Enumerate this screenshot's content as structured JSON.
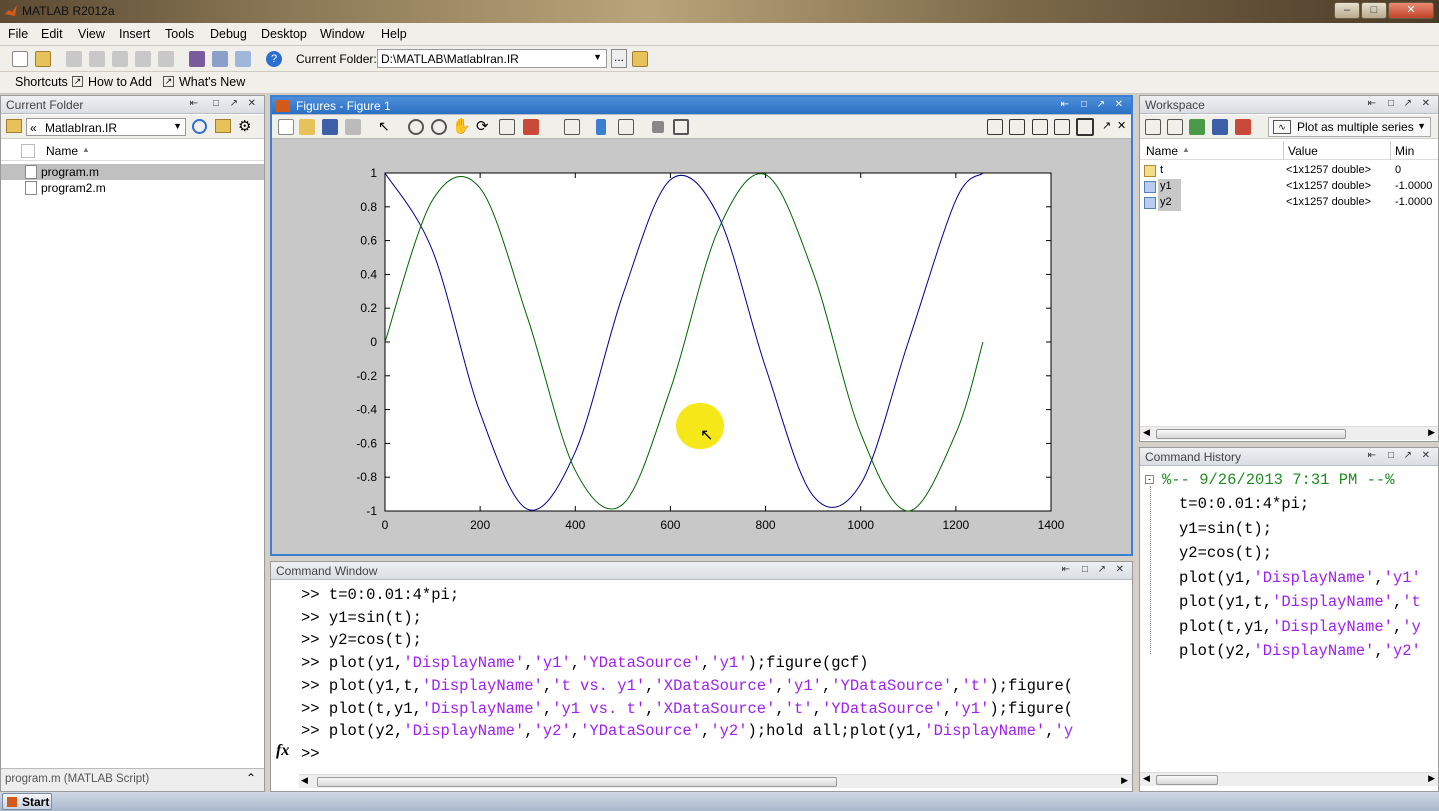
{
  "app": {
    "title": "MATLAB  R2012a"
  },
  "menu": [
    "File",
    "Edit",
    "View",
    "Insert",
    "Tools",
    "Debug",
    "Desktop",
    "Window",
    "Help"
  ],
  "toolbar": {
    "folder_label": "Current Folder:",
    "folder_value": "D:\\MATLAB\\MatlabIran.IR"
  },
  "shortcuts": {
    "shortcuts": "Shortcuts",
    "how_to_add": "How to Add",
    "whats_new": "What's New"
  },
  "current_folder": {
    "title": "Current Folder",
    "path": "MatlabIran.IR",
    "column": "Name",
    "files": [
      "program.m",
      "program2.m"
    ],
    "status": "program.m (MATLAB Script)"
  },
  "figure": {
    "title": "Figures - Figure 1"
  },
  "workspace": {
    "title": "Workspace",
    "plot_button": "Plot as multiple series",
    "columns": [
      "Name",
      "Value",
      "Min"
    ],
    "vars": [
      {
        "name": "t",
        "value": "<1x1257 double>",
        "min": "0"
      },
      {
        "name": "y1",
        "value": "<1x1257 double>",
        "min": "-1.0000"
      },
      {
        "name": "y2",
        "value": "<1x1257 double>",
        "min": "-1.0000"
      }
    ]
  },
  "command_window": {
    "title": "Command Window",
    "lines": [
      [
        {
          "t": ">> t=0:0.01:4*pi;",
          "s": 0
        }
      ],
      [
        {
          "t": ">> y1=sin(t);",
          "s": 0
        }
      ],
      [
        {
          "t": ">> y2=cos(t);",
          "s": 0
        }
      ],
      [
        {
          "t": ">> plot(y1,",
          "s": 0
        },
        {
          "t": "'DisplayName'",
          "s": 1
        },
        {
          "t": ",",
          "s": 0
        },
        {
          "t": "'y1'",
          "s": 1
        },
        {
          "t": ",",
          "s": 0
        },
        {
          "t": "'YDataSource'",
          "s": 1
        },
        {
          "t": ",",
          "s": 0
        },
        {
          "t": "'y1'",
          "s": 1
        },
        {
          "t": ");figure(gcf)",
          "s": 0
        }
      ],
      [
        {
          "t": ">> plot(y1,t,",
          "s": 0
        },
        {
          "t": "'DisplayName'",
          "s": 1
        },
        {
          "t": ",",
          "s": 0
        },
        {
          "t": "'t vs. y1'",
          "s": 1
        },
        {
          "t": ",",
          "s": 0
        },
        {
          "t": "'XDataSource'",
          "s": 1
        },
        {
          "t": ",",
          "s": 0
        },
        {
          "t": "'y1'",
          "s": 1
        },
        {
          "t": ",",
          "s": 0
        },
        {
          "t": "'YDataSource'",
          "s": 1
        },
        {
          "t": ",",
          "s": 0
        },
        {
          "t": "'t'",
          "s": 1
        },
        {
          "t": ");figure(",
          "s": 0
        }
      ],
      [
        {
          "t": ">> plot(t,y1,",
          "s": 0
        },
        {
          "t": "'DisplayName'",
          "s": 1
        },
        {
          "t": ",",
          "s": 0
        },
        {
          "t": "'y1 vs. t'",
          "s": 1
        },
        {
          "t": ",",
          "s": 0
        },
        {
          "t": "'XDataSource'",
          "s": 1
        },
        {
          "t": ",",
          "s": 0
        },
        {
          "t": "'t'",
          "s": 1
        },
        {
          "t": ",",
          "s": 0
        },
        {
          "t": "'YDataSource'",
          "s": 1
        },
        {
          "t": ",",
          "s": 0
        },
        {
          "t": "'y1'",
          "s": 1
        },
        {
          "t": ");figure(",
          "s": 0
        }
      ],
      [
        {
          "t": ">> plot(y2,",
          "s": 0
        },
        {
          "t": "'DisplayName'",
          "s": 1
        },
        {
          "t": ",",
          "s": 0
        },
        {
          "t": "'y2'",
          "s": 1
        },
        {
          "t": ",",
          "s": 0
        },
        {
          "t": "'YDataSource'",
          "s": 1
        },
        {
          "t": ",",
          "s": 0
        },
        {
          "t": "'y2'",
          "s": 1
        },
        {
          "t": ");hold all;plot(y1,",
          "s": 0
        },
        {
          "t": "'DisplayName'",
          "s": 1
        },
        {
          "t": ",",
          "s": 0
        },
        {
          "t": "'y",
          "s": 1
        }
      ]
    ],
    "fx": "fx",
    "prompt": ">>"
  },
  "command_history": {
    "title": "Command History",
    "session": "%-- 9/26/2013 7:31 PM --%",
    "lines": [
      [
        {
          "t": "t=0:0.01:4*pi;",
          "s": 0
        }
      ],
      [
        {
          "t": "y1=sin(t);",
          "s": 0
        }
      ],
      [
        {
          "t": "y2=cos(t);",
          "s": 0
        }
      ],
      [
        {
          "t": "plot(y1,",
          "s": 0
        },
        {
          "t": "'DisplayName'",
          "s": 1
        },
        {
          "t": ",",
          "s": 0
        },
        {
          "t": "'y1'",
          "s": 1
        }
      ],
      [
        {
          "t": "plot(y1,t,",
          "s": 0
        },
        {
          "t": "'DisplayName'",
          "s": 1
        },
        {
          "t": ",",
          "s": 0
        },
        {
          "t": "'t",
          "s": 1
        }
      ],
      [
        {
          "t": "plot(t,y1,",
          "s": 0
        },
        {
          "t": "'DisplayName'",
          "s": 1
        },
        {
          "t": ",",
          "s": 0
        },
        {
          "t": "'y",
          "s": 1
        }
      ],
      [
        {
          "t": "plot(y2,",
          "s": 0
        },
        {
          "t": "'DisplayName'",
          "s": 1
        },
        {
          "t": ",",
          "s": 0
        },
        {
          "t": "'y2'",
          "s": 1
        }
      ]
    ]
  },
  "taskbar": {
    "start": "Start"
  },
  "chart_data": {
    "type": "line",
    "x": [
      0,
      100,
      200,
      300,
      400,
      500,
      600,
      700,
      800,
      900,
      1000,
      1100,
      1200,
      1257
    ],
    "series": [
      {
        "color": "#00008b",
        "values": [
          1,
          0.54,
          -0.42,
          -0.99,
          -0.65,
          0.28,
          0.96,
          0.75,
          -0.15,
          -0.91,
          -0.84,
          0.0,
          0.84,
          1.0
        ]
      },
      {
        "color": "#006400",
        "values": [
          0,
          0.84,
          0.91,
          0.14,
          -0.76,
          -0.96,
          -0.28,
          0.66,
          0.99,
          0.41,
          -0.54,
          -1.0,
          -0.54,
          0.0
        ]
      }
    ],
    "xticks": [
      0,
      200,
      400,
      600,
      800,
      1000,
      1200,
      1400
    ],
    "yticks": [
      -1,
      -0.8,
      -0.6,
      -0.4,
      -0.2,
      0,
      0.2,
      0.4,
      0.6,
      0.8,
      1
    ],
    "xlim": [
      0,
      1400
    ],
    "ylim": [
      -1,
      1
    ],
    "grid": false
  }
}
